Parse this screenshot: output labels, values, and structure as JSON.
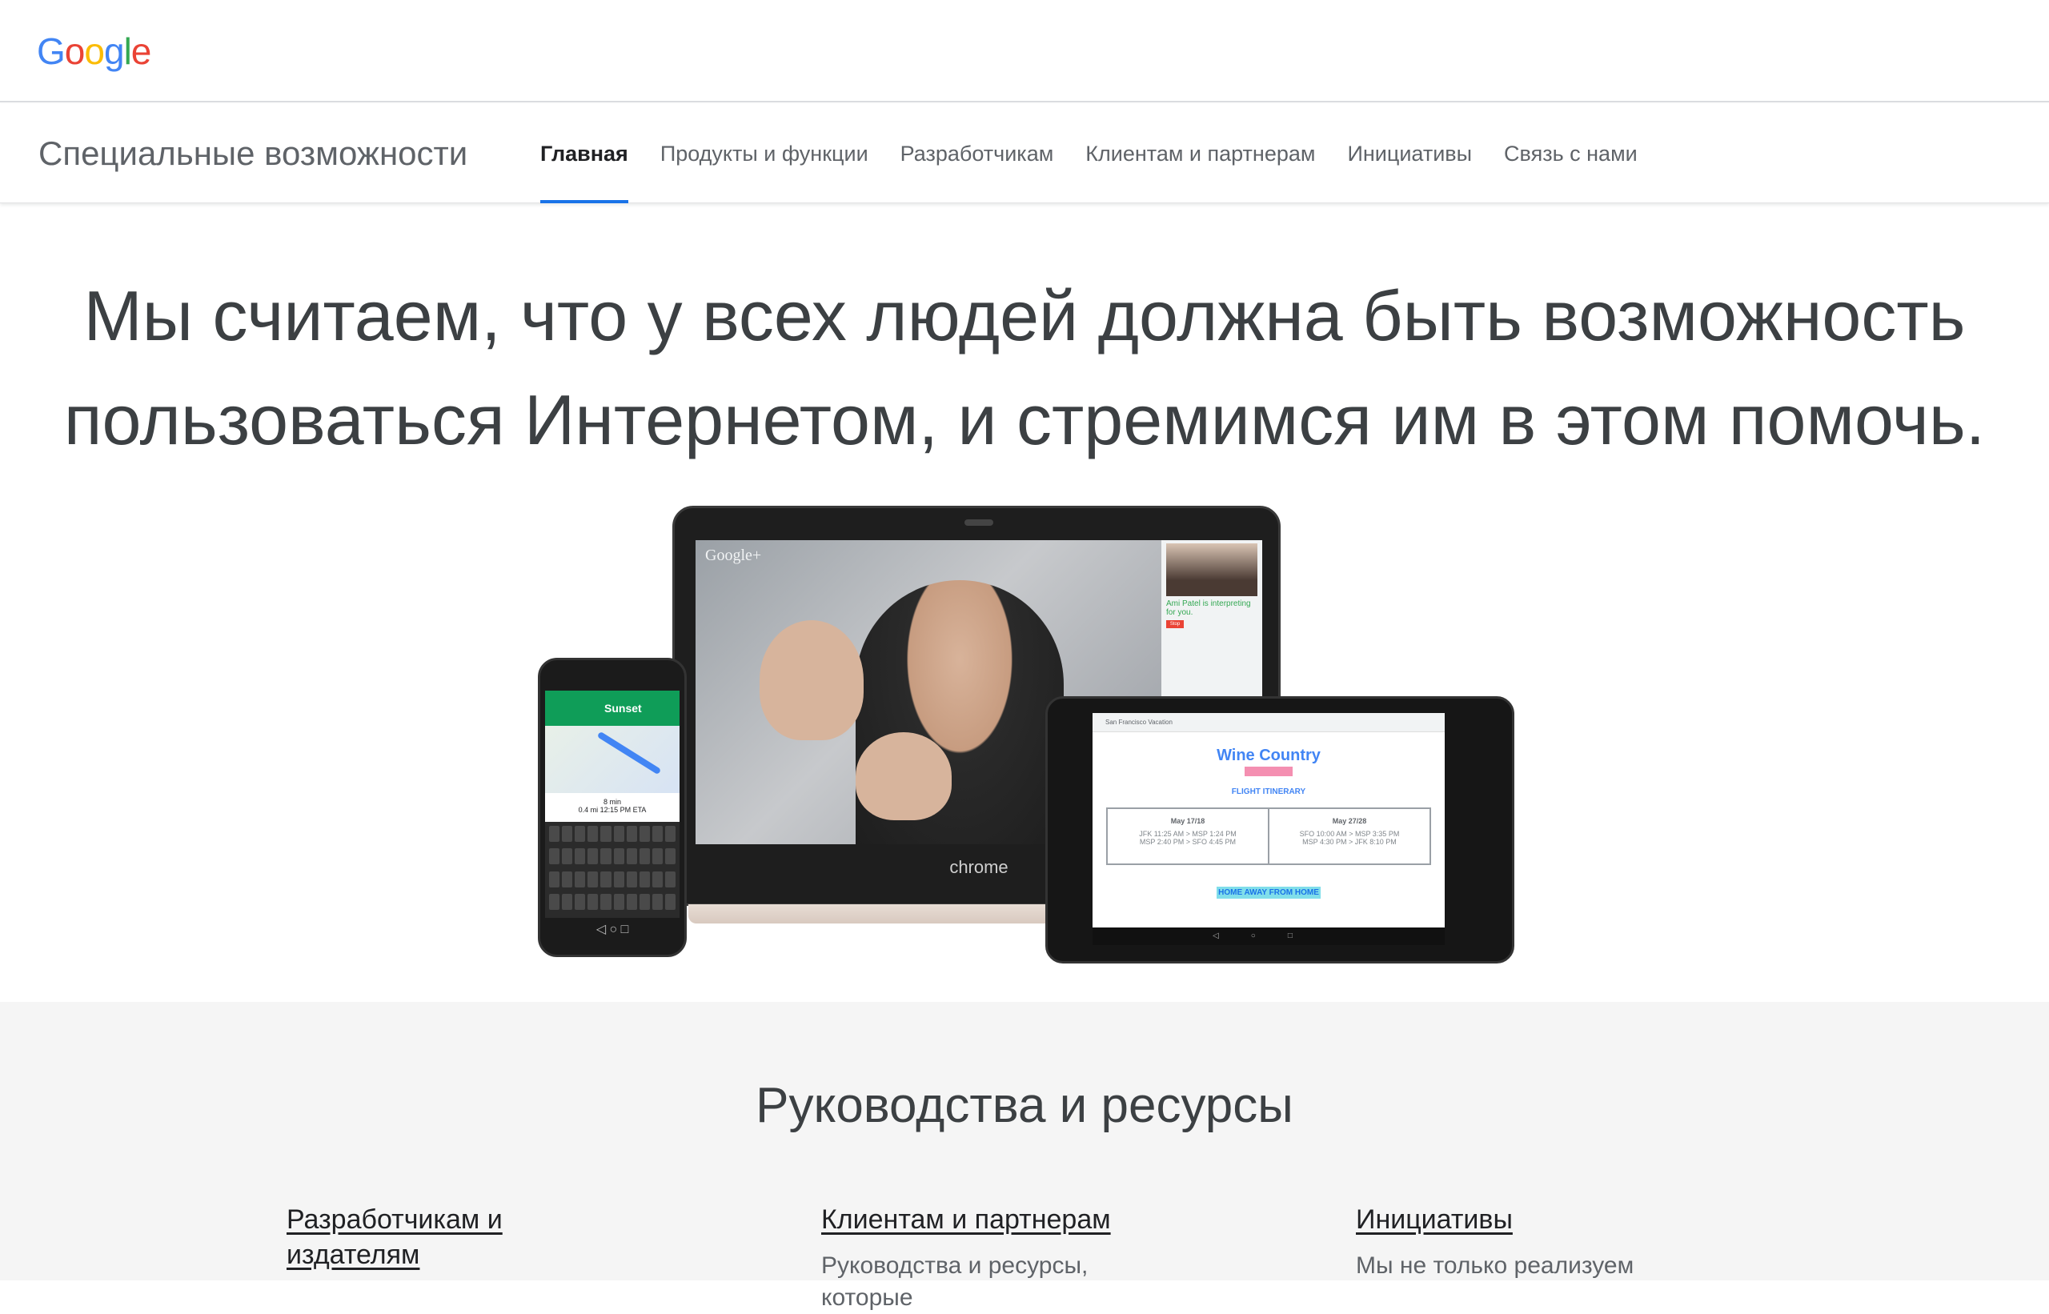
{
  "header": {
    "logo_letters": [
      {
        "char": "G",
        "color": "#4285f4"
      },
      {
        "char": "o",
        "color": "#ea4335"
      },
      {
        "char": "o",
        "color": "#fbbc05"
      },
      {
        "char": "g",
        "color": "#4285f4"
      },
      {
        "char": "l",
        "color": "#34a853"
      },
      {
        "char": "e",
        "color": "#ea4335"
      }
    ]
  },
  "nav": {
    "site_title": "Специальные возможности",
    "items": [
      {
        "label": "Главная",
        "active": true
      },
      {
        "label": "Продукты и функции",
        "active": false
      },
      {
        "label": "Разработчикам",
        "active": false
      },
      {
        "label": "Клиентам и партнерам",
        "active": false
      },
      {
        "label": "Инициативы",
        "active": false
      },
      {
        "label": "Связь с нами",
        "active": false
      }
    ],
    "accent_color": "#1a73e8"
  },
  "hero": {
    "heading_line1": "Мы считаем, что у всех людей должна быть возможность",
    "heading_line2": "пользоваться Интернетом, и стремимся им в этом помочь.",
    "image": {
      "laptop_brand": "chrome",
      "laptop_app_label": "Google+",
      "laptop_side_text": "Ami Patel is interpreting for you.",
      "laptop_side_button": "Stop",
      "phone_destination": "Sunset",
      "phone_eta_line1": "8 min",
      "phone_eta_line2": "0.4 mi  12:15 PM ETA",
      "tablet_toolbar": "San Francisco Vacation",
      "tablet_title": "Wine Country",
      "tablet_subtitle": "FLIGHT ITINERARY",
      "tablet_col1_date": "May 17/18",
      "tablet_col1_line1": "JFK 11:25 AM > MSP 1:24 PM",
      "tablet_col1_line2": "MSP 2:40 PM > SFO 4:45 PM",
      "tablet_col2_date": "May 27/28",
      "tablet_col2_line1": "SFO 10:00 AM > MSP 3:35 PM",
      "tablet_col2_line2": "MSP 4:30 PM > JFK 8:10 PM",
      "tablet_footer_link": "HOME AWAY FROM HOME"
    }
  },
  "guides": {
    "title": "Руководства и ресурсы",
    "columns": [
      {
        "link": "Разработчикам и издателям",
        "desc": ""
      },
      {
        "link": "Клиентам и партнерам",
        "desc": "Руководства и ресурсы, которые"
      },
      {
        "link": "Инициативы",
        "desc": "Мы не только реализуем"
      }
    ],
    "background": "#f5f5f5"
  }
}
